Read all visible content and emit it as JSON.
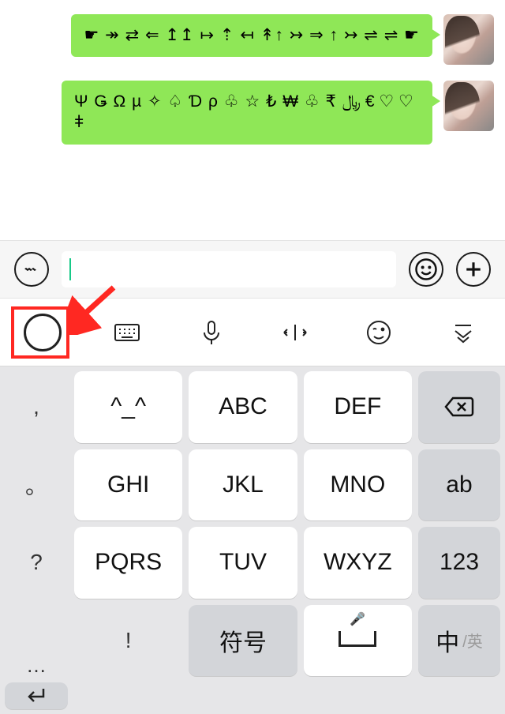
{
  "chat": {
    "messages": [
      {
        "text": "☛ ↠ ⇄ ⇐ ↥↥ ↦ ⇡ ↤ ↟↑ ↣ ⇒ ↑ ↣ ⇌ ⇌ ☛"
      },
      {
        "text": "Ψ Ǥ Ω µ ✧ ♤ Ɗ ρ ♧ ☆ ₺ ₩ ♧ ₹ ﷼ € ♡ ♡ ǂ"
      }
    ]
  },
  "inputbar": {
    "voice_icon": "voice",
    "smile_icon": "smile",
    "plus_icon": "plus",
    "placeholder": ""
  },
  "toolbar": {
    "items": [
      "circle",
      "keyboard",
      "mic",
      "cursor",
      "emoji",
      "dropdown"
    ]
  },
  "keyboard": {
    "side": [
      ",",
      "。",
      "?",
      "!",
      "…"
    ],
    "rows": [
      [
        "^_^",
        "ABC",
        "DEF"
      ],
      [
        "GHI",
        "JKL",
        "MNO"
      ],
      [
        "PQRS",
        "TUV",
        "WXYZ"
      ]
    ],
    "bottom": {
      "symbols": "符号",
      "lang_main": "中",
      "lang_sub": "/英"
    },
    "right": {
      "backspace": "⌫",
      "shift": "ab",
      "numbers": "123",
      "enter": "↵"
    }
  }
}
